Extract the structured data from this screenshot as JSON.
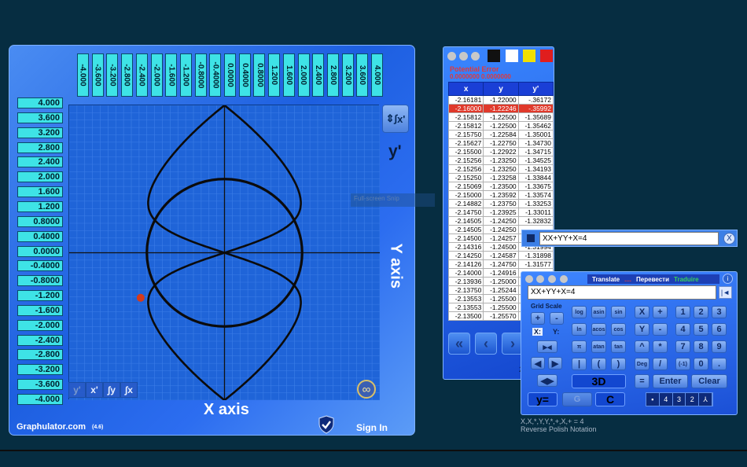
{
  "main_window": {
    "x_ticks": [
      "-4.000",
      "-3.600",
      "-3.200",
      "-2.800",
      "-2.400",
      "-2.000",
      "-1.600",
      "-1.200",
      "-0.8000",
      "-0.4000",
      "0.0000",
      "0.4000",
      "0.8000",
      "1.200",
      "1.600",
      "2.000",
      "2.400",
      "2.800",
      "3.200",
      "3.600",
      "4.000"
    ],
    "y_ticks": [
      "4.000",
      "3.600",
      "3.200",
      "2.800",
      "2.400",
      "2.000",
      "1.600",
      "1.200",
      "0.8000",
      "0.4000",
      "0.0000",
      "-0.4000",
      "-0.8000",
      "-1.200",
      "-1.600",
      "-2.000",
      "-2.400",
      "-2.800",
      "-3.200",
      "-3.600",
      "-4.000"
    ],
    "yprime_button": "x'",
    "side_yprime": "y'",
    "y_axis_title": "Y axis",
    "x_axis_title": "X axis",
    "brand": "Graphulator.com",
    "version": "(4.6)",
    "sign_in": "Sign In",
    "ghost_text": "Full-screen Snip",
    "mini_tabs": [
      "y'",
      "x'",
      "∫y",
      "∫x"
    ],
    "infinity_icon": "infinity-icon",
    "plot": {
      "x_range": [
        -4,
        4
      ],
      "y_range": [
        -4,
        4
      ],
      "circle_radius": 2,
      "marked_point": {
        "x": -2.16,
        "y": -1.22246
      },
      "colors": {
        "background": "#1f64d8",
        "grid": "#3d7ee8",
        "axes": "#111111",
        "curve": "#0b0b0b",
        "point": "#d63a1a"
      }
    }
  },
  "table_window": {
    "swatch_colors": [
      "#111111",
      "#ffffff",
      "#f0e000",
      "#e01e1e"
    ],
    "title": "Potential Error",
    "values": "0.0000000 0.0000000",
    "headers": [
      "x",
      "y",
      "y'"
    ],
    "selected_row": 1,
    "rows": [
      [
        "-2.16181",
        "-1.22000",
        "-.36172"
      ],
      [
        "-2.16000",
        "-1.22246",
        "-.35992"
      ],
      [
        "-2.15812",
        "-1.22500",
        "-1.35689"
      ],
      [
        "-2.15812",
        "-1.22500",
        "-1.35462"
      ],
      [
        "-2.15750",
        "-1.22584",
        "-1.35001"
      ],
      [
        "-2.15627",
        "-1.22750",
        "-1.34730"
      ],
      [
        "-2.15500",
        "-1.22922",
        "-1.34715"
      ],
      [
        "-2.15256",
        "-1.23250",
        "-1.34525"
      ],
      [
        "-2.15256",
        "-1.23250",
        "-1.34193"
      ],
      [
        "-2.15250",
        "-1.23258",
        "-1.33844"
      ],
      [
        "-2.15069",
        "-1.23500",
        "-1.33675"
      ],
      [
        "-2.15000",
        "-1.23592",
        "-1.33574"
      ],
      [
        "-2.14882",
        "-1.23750",
        "-1.33253"
      ],
      [
        "-2.14750",
        "-1.23925",
        "-1.33011"
      ],
      [
        "-2.14505",
        "-1.24250",
        "-1.32832"
      ],
      [
        "-2.14505",
        "-1.24250",
        ""
      ],
      [
        "-2.14500",
        "-1.24257",
        ""
      ],
      [
        "-2.14316",
        "-1.24500",
        "-1.31994"
      ],
      [
        "-2.14250",
        "-1.24587",
        "-1.31898"
      ],
      [
        "-2.14126",
        "-1.24750",
        "-1.31577"
      ],
      [
        "-2.14000",
        "-1.24916",
        ""
      ],
      [
        "-2.13936",
        "-1.25000",
        ""
      ],
      [
        "-2.13750",
        "-1.25244",
        ""
      ],
      [
        "-2.13553",
        "-1.25500",
        ""
      ],
      [
        "-2.13553",
        "-1.25500",
        ""
      ],
      [
        "-2.13500",
        "-1.25570",
        ""
      ]
    ],
    "nav": [
      "«",
      "‹",
      "›"
    ],
    "fragment": "2"
  },
  "equation_bar": {
    "value": "XX+YY+X=4",
    "close": "X"
  },
  "keypad": {
    "translate": "Translate",
    "translate_red": "....",
    "translate_ru": "Перевести",
    "translate_pt": "Traduire",
    "info": "i",
    "input_value": "XX+YY+X=4",
    "backspace": "|◄",
    "grid_scale": "Grid Scale",
    "x_label": "X:",
    "y_label": "Y:",
    "keys": {
      "plus": "+",
      "minus": "-",
      "arrows_h": "▸◂",
      "left": "◀",
      "right": "▶",
      "lr": "◀▶",
      "log": "log",
      "asin": "asin",
      "sin": "sin",
      "ln": "ln",
      "acos": "acos",
      "cos": "cos",
      "pi": "π",
      "atan": "atan",
      "tan": "tan",
      "abs": "|",
      "lparen": "(",
      "rparen": ")",
      "three_d": "3D",
      "X": "X",
      "Y": "Y",
      "pow": "^",
      "deg": "Deg",
      "eq": "=",
      "add": "+",
      "sub": "-",
      "mul": "*",
      "div": "/",
      "neg": "(-1)",
      "d1": "1",
      "d2": "2",
      "d3": "3",
      "d4": "4",
      "d5": "5",
      "d6": "6",
      "d7": "7",
      "d8": "8",
      "d9": "9",
      "d0": "0",
      "dot": ".",
      "enter": "Enter",
      "clear": "Clear",
      "yeq": "y=",
      "G": "G",
      "C": "C"
    },
    "bottom_bar": [
      "4",
      "3",
      "2"
    ]
  },
  "captions": {
    "line1": "X,X,*,Y,Y,*,+,X,+ = 4",
    "line2": "Reverse Polish Notation"
  }
}
